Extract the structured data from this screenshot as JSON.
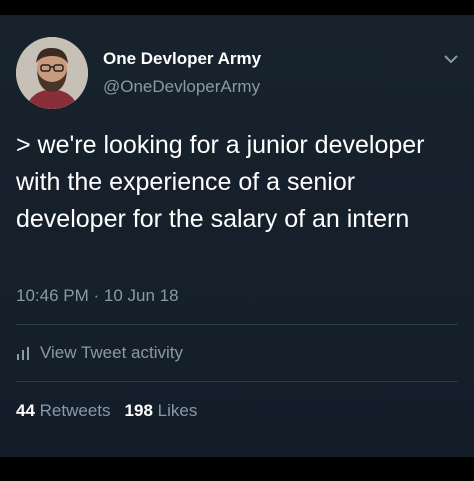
{
  "tweet": {
    "author": {
      "display_name": "One Devloper Army",
      "handle": "@OneDevloperArmy",
      "avatar_icon": "bearded-man-avatar"
    },
    "text": "> we're looking for a junior developer with the experience of a senior developer for the salary of an intern",
    "timestamp": "10:46 PM · 10 Jun 18",
    "activity_label": "View Tweet activity",
    "retweets_count": "44",
    "retweets_label": "Retweets",
    "likes_count": "198",
    "likes_label": "Likes"
  },
  "colors": {
    "background": "#15202b",
    "text": "#ffffff",
    "secondary_text": "#8b98a5",
    "divider": "#2a3a4a"
  }
}
